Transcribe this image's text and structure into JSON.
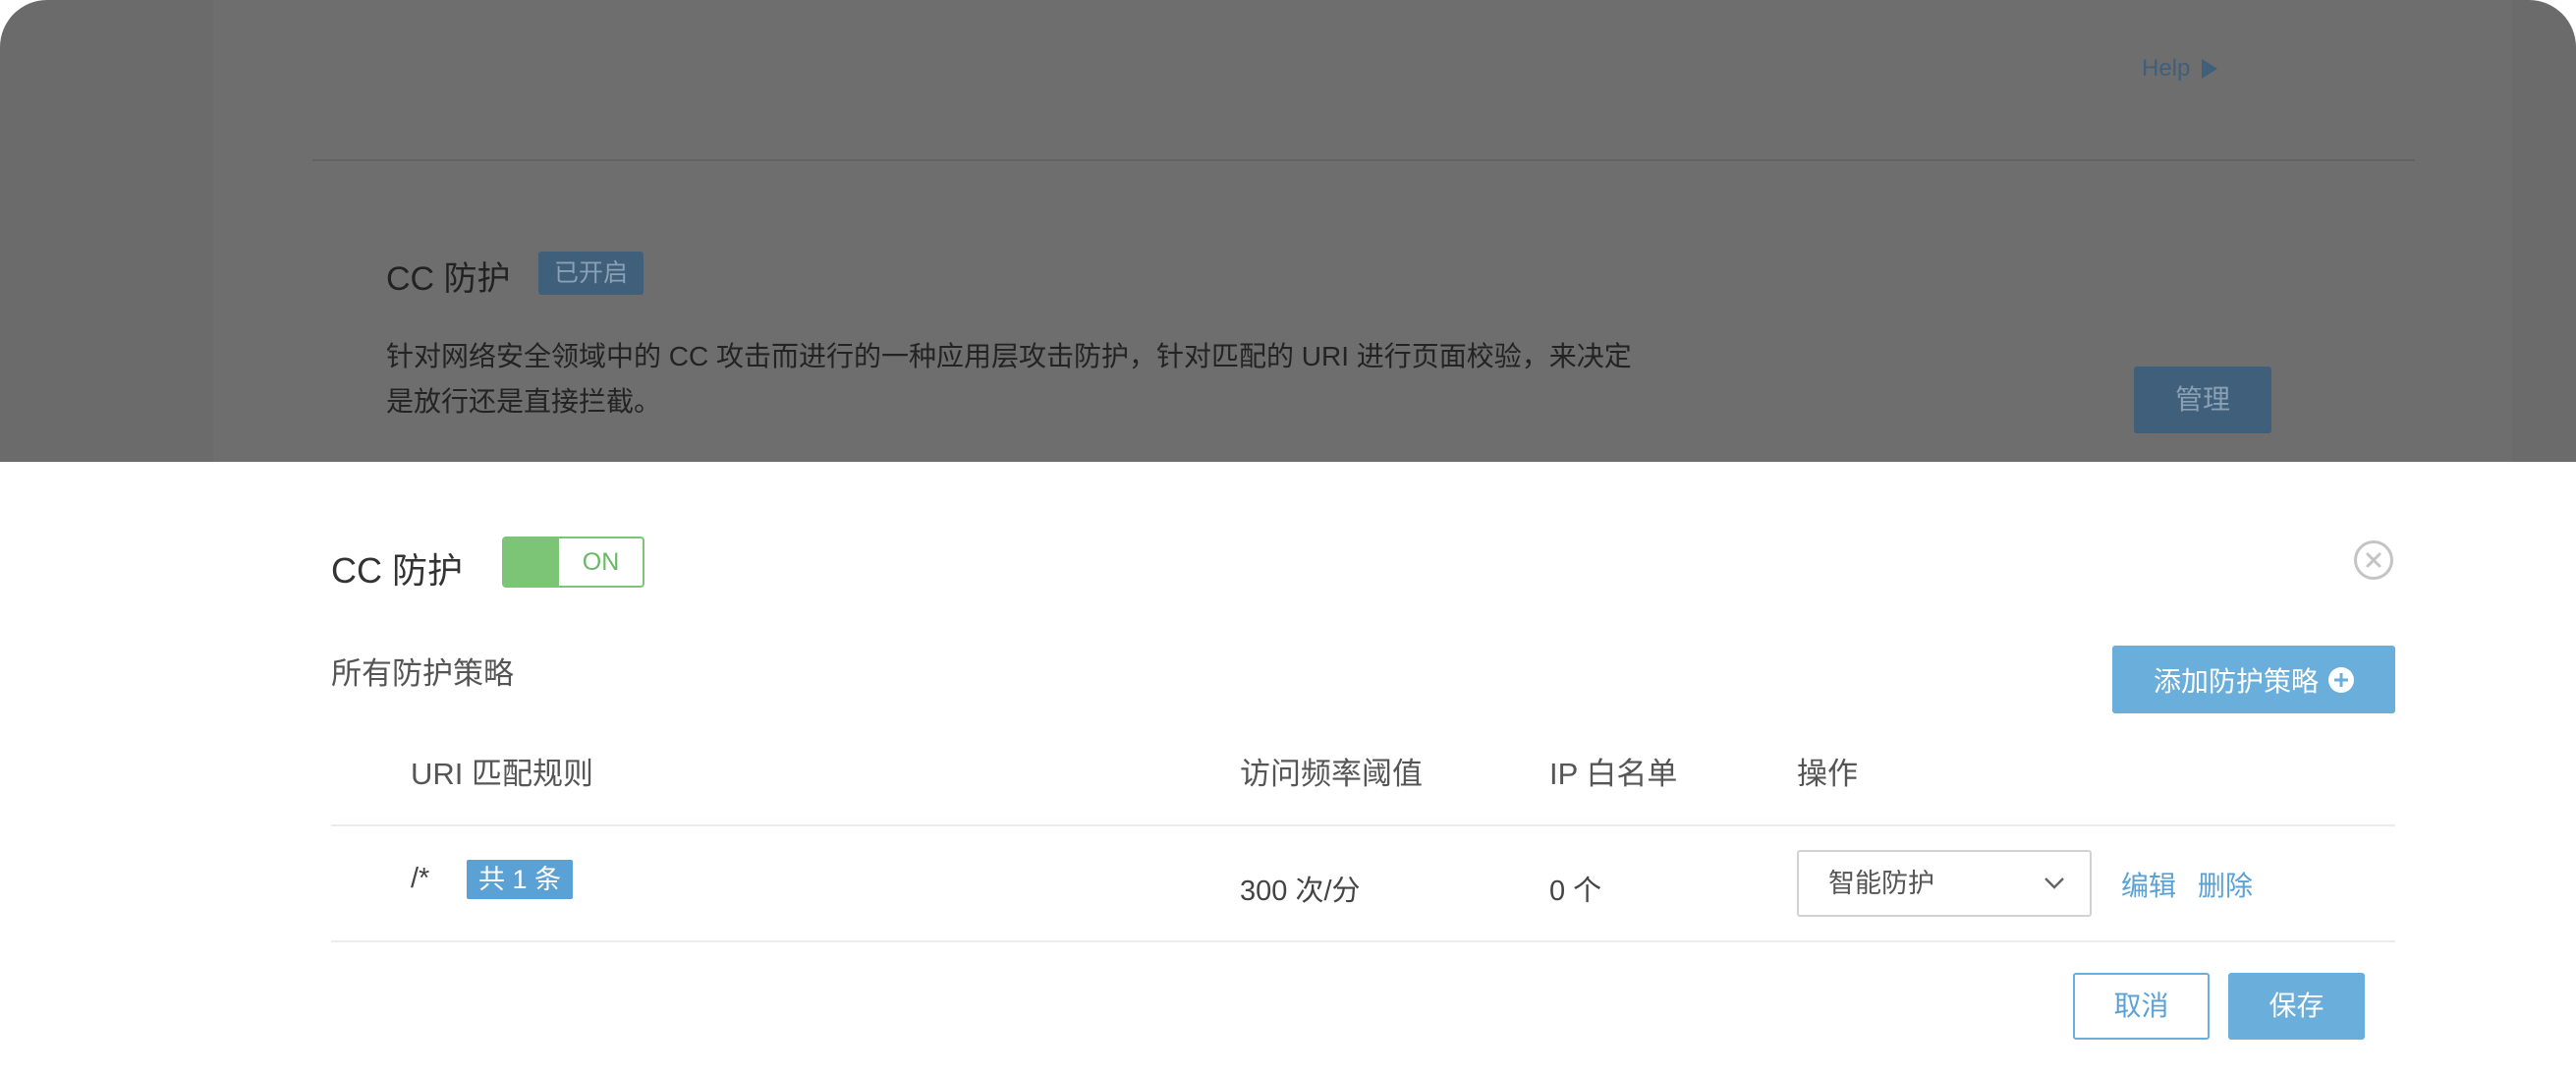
{
  "background": {
    "help_label": "Help",
    "section_title": "CC 防护",
    "status_badge": "已开启",
    "description_line1": "针对网络安全领域中的 CC 攻击而进行的一种应用层攻击防护，针对匹配的 URI 进行页面校验，来决定",
    "description_line2": "是放行还是直接拦截。",
    "manage_label": "管理"
  },
  "panel": {
    "title": "CC 防护",
    "toggle_state": "ON",
    "toggle_color": "#7cc576",
    "section_label": "所有防护策略",
    "add_button_label": "添加防护策略",
    "table": {
      "headers": [
        "URI 匹配规则",
        "访问频率阈值",
        "IP 白名单",
        "操作"
      ],
      "rows": [
        {
          "uri": "/*",
          "count_badge": "共 1 条",
          "threshold": "300 次/分",
          "whitelist": "0 个",
          "mode": "智能防护",
          "edit_label": "编辑",
          "delete_label": "删除"
        }
      ]
    },
    "cancel_label": "取消",
    "save_label": "保存",
    "accent_color": "#6aaedb"
  }
}
